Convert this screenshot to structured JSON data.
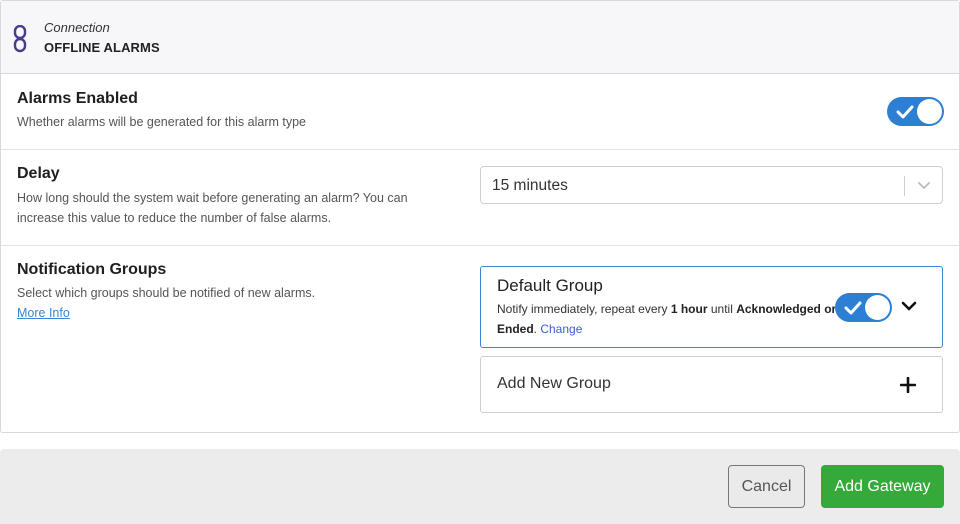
{
  "header": {
    "subtitle": "Connection",
    "title": "OFFLINE ALARMS",
    "icon": "link-icon"
  },
  "alarms_enabled": {
    "title": "Alarms Enabled",
    "description": "Whether alarms will be generated for this alarm type",
    "enabled": true
  },
  "delay": {
    "title": "Delay",
    "description": "How long should the system wait before generating an alarm? You can increase this value to reduce the number of false alarms.",
    "selected": "15 minutes"
  },
  "notification_groups": {
    "title": "Notification Groups",
    "description": "Select which groups should be notified of new alarms.",
    "more_info": "More Info",
    "groups": [
      {
        "name": "Default Group",
        "desc_prefix": "Notify immediately, repeat every ",
        "repeat": "1 hour",
        "desc_mid": " until ",
        "until": "Acknowledged or Ended",
        "desc_suffix": ". ",
        "change_label": "Change",
        "enabled": true
      }
    ],
    "add_label": "Add New Group"
  },
  "footer": {
    "cancel_label": "Cancel",
    "submit_label": "Add Gateway"
  },
  "colors": {
    "toggle_on": "#2d7fd3",
    "submit": "#35aa3a",
    "link": "#3a86d6",
    "accent": "#4a3c8c"
  }
}
